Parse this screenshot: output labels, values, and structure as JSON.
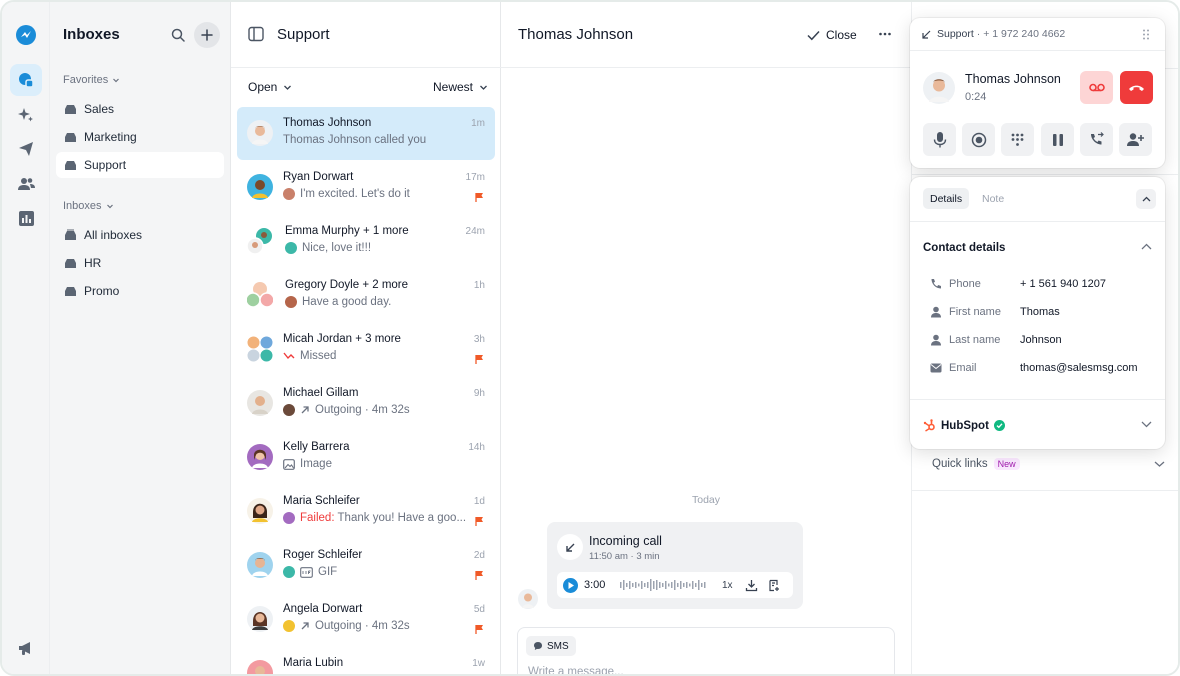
{
  "colors": {
    "brand": "#1a8cd8",
    "selected_bg": "#d4ebfa",
    "danger": "#ef3b3b",
    "flag": "#f05a28",
    "online": "#10b981"
  },
  "sidebar": {
    "title": "Inboxes",
    "favorites_label": "Favorites",
    "favorites": [
      {
        "label": "Sales"
      },
      {
        "label": "Marketing"
      },
      {
        "label": "Support"
      }
    ],
    "inboxes_label": "Inboxes",
    "inboxes": [
      {
        "label": "All inboxes"
      },
      {
        "label": "HR"
      },
      {
        "label": "Promo"
      }
    ]
  },
  "list": {
    "title": "Support",
    "filter_status": "Open",
    "filter_sort": "Newest",
    "conversations": [
      {
        "name": "Thomas Johnson",
        "time": "1m",
        "preview": "Thomas Johnson called you"
      },
      {
        "name": "Ryan Dorwart",
        "time": "17m",
        "preview": "I'm excited. Let's do it"
      },
      {
        "name": "Emma Murphy + 1 more",
        "time": "24m",
        "preview": "Nice, love it!!!"
      },
      {
        "name": "Gregory Doyle + 2 more",
        "time": "1h",
        "preview": "Have a good day."
      },
      {
        "name": "Micah Jordan + 3 more",
        "time": "3h",
        "preview": "Missed"
      },
      {
        "name": "Michael Gillam",
        "time": "9h",
        "preview": "Outgoing · 4m 32s"
      },
      {
        "name": "Kelly Barrera",
        "time": "14h",
        "preview": "Image"
      },
      {
        "name": "Maria Schleifer",
        "time": "1d",
        "preview_prefix": "Failed:",
        "preview": "Thank you! Have a goo..."
      },
      {
        "name": "Roger Schleifer",
        "time": "2d",
        "preview": "GIF"
      },
      {
        "name": "Angela Dorwart",
        "time": "5d",
        "preview": "Outgoing · 4m 32s"
      },
      {
        "name": "Maria Lubin",
        "time": "1w",
        "preview": ""
      }
    ]
  },
  "chat": {
    "contact_name": "Thomas Johnson",
    "close_label": "Close",
    "day_separator": "Today",
    "call_title": "Incoming call",
    "call_meta": "11:50 am · 3 min",
    "duration": "3:00",
    "speed": "1x",
    "sms_label": "SMS",
    "placeholder": "Write a message..."
  },
  "call_panel": {
    "inbox": "Support",
    "number": "· + 1 972 240 4662",
    "name": "Thomas Johnson",
    "timer": "0:24"
  },
  "details": {
    "tab_details": "Details",
    "tab_note": "Note",
    "section_title": "Contact details",
    "fields": [
      {
        "label": "Phone",
        "value": "+ 1 561 940 1207"
      },
      {
        "label": "First name",
        "value": "Thomas"
      },
      {
        "label": "Last name",
        "value": "Johnson"
      },
      {
        "label": "Email",
        "value": "thomas@salesmsg.com"
      }
    ],
    "integration": "HubSpot",
    "quick_links": "Quick links",
    "quick_links_badge": "New"
  }
}
